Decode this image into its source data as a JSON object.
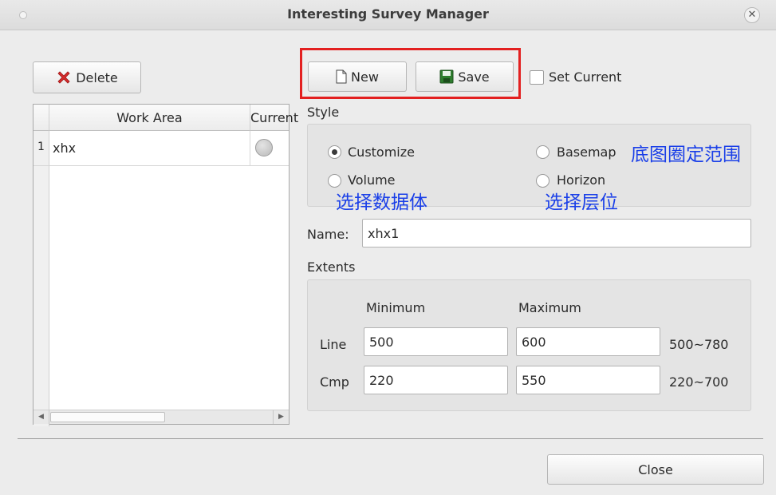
{
  "window": {
    "title": "Interesting Survey Manager"
  },
  "left": {
    "delete_label": "Delete",
    "table": {
      "headers": [
        "Work Area",
        "Current"
      ],
      "rows": [
        {
          "num": "1",
          "work_area": "xhx"
        }
      ]
    }
  },
  "toolbar": {
    "new_label": "New",
    "save_label": "Save",
    "set_current_label": "Set Current"
  },
  "style": {
    "title": "Style",
    "options": {
      "customize": "Customize",
      "basemap": "Basemap",
      "volume": "Volume",
      "horizon": "Horizon"
    },
    "selected": "Customize",
    "annotations": {
      "basemap": "底图圈定范围",
      "volume": "选择数据体",
      "horizon": "选择层位"
    }
  },
  "name": {
    "label": "Name:",
    "value": "xhx1"
  },
  "extents": {
    "title": "Extents",
    "min_label": "Minimum",
    "max_label": "Maximum",
    "line": {
      "label": "Line",
      "min": "500",
      "max": "600",
      "range": "500~780"
    },
    "cmp": {
      "label": "Cmp",
      "min": "220",
      "max": "550",
      "range": "220~700"
    }
  },
  "footer": {
    "close_label": "Close"
  },
  "colors": {
    "highlight": "#e32020",
    "annotation": "#1a3fe8",
    "delete_x": "#d62b2b",
    "save_icon": "#2e7d2e"
  }
}
